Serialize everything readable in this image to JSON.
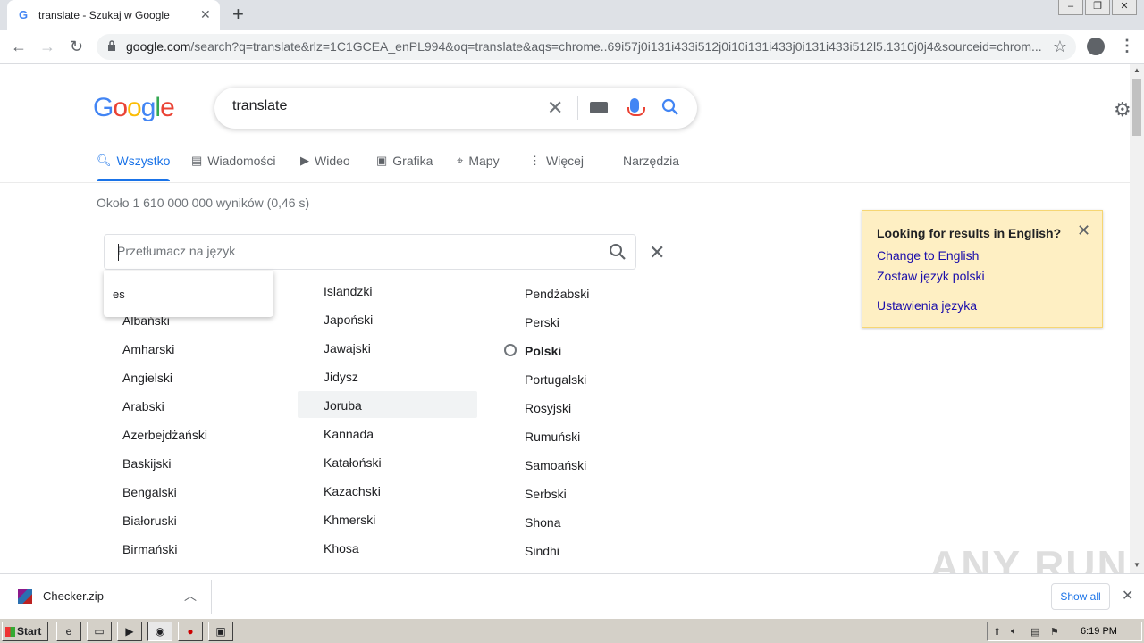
{
  "browser": {
    "tab_title": "translate - Szukaj w Google",
    "tab_favicon": "G",
    "url_host": "google.com",
    "url_path": "/search?q=translate&rlz=1C1GCEA_enPL994&oq=translate&aqs=chrome..69i57j0i131i433i512j0i10i131i433j0i131i433i512l5.1310j0j4&sourceid=chrom..."
  },
  "search": {
    "query": "translate"
  },
  "nav_tabs": [
    {
      "label": "Wszystko",
      "icon": "search-icon"
    },
    {
      "label": "Wiadomości",
      "icon": "news-icon"
    },
    {
      "label": "Wideo",
      "icon": "video-icon"
    },
    {
      "label": "Grafika",
      "icon": "image-icon"
    },
    {
      "label": "Mapy",
      "icon": "map-pin-icon"
    },
    {
      "label": "Więcej",
      "icon": "more-vert-icon"
    },
    {
      "label": "Narzędzia",
      "icon": ""
    }
  ],
  "result_stats": "Około 1 610 000 000 wyników (0,46 s)",
  "translator": {
    "placeholder": "Przetłumacz na język",
    "autocomplete": "es",
    "columns": [
      [
        "Albański",
        "Amharski",
        "Angielski",
        "Arabski",
        "Azerbejdżański",
        "Baskijski",
        "Bengalski",
        "Białoruski",
        "Birmański"
      ],
      [
        "Islandzki",
        "Japoński",
        "Jawajski",
        "Jidysz",
        "Joruba",
        "Kannada",
        "Katałoński",
        "Kazachski",
        "Khmerski",
        "Khosa"
      ],
      [
        "Pendżabski",
        "Perski",
        "Polski",
        "Portugalski",
        "Rosyjski",
        "Rumuński",
        "Samoański",
        "Serbski",
        "Shona",
        "Sindhi"
      ]
    ],
    "highlighted": "Joruba",
    "selected": "Polski"
  },
  "language_notice": {
    "title": "Looking for results in English?",
    "change": "Change to English",
    "keep": "Zostaw język polski",
    "settings": "Ustawienia języka"
  },
  "download": {
    "file": "Checker.zip",
    "show_all": "Show all"
  },
  "watermark": "ANY RUN",
  "taskbar": {
    "start": "Start",
    "clock": "6:19 PM"
  }
}
